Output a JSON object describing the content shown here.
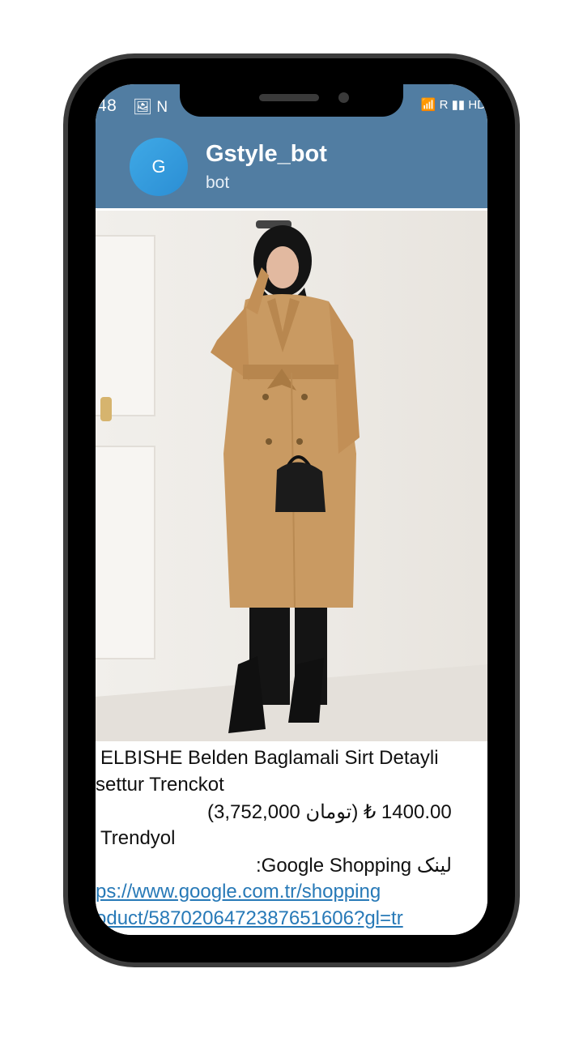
{
  "status_bar": {
    "time": "48",
    "left_icons": "🖼 N",
    "right_icons": "📶 R ▮▮ HD"
  },
  "chat": {
    "avatar_letter": "G",
    "title": "Gstyle_bot",
    "subtitle": "bot"
  },
  "message": {
    "product_line1": "ELBISHE Belden Baglamali Sirt Detayli",
    "product_line2": "settur Trenckot",
    "price": "(3,752,000 تومان) ₺ 1400.00",
    "store": "Trendyol",
    "google_label": ":Google Shopping لینک",
    "link_line1": "ps://www.google.com.tr/shopping",
    "link_line2": "oduct/5870206472387651606?gl=tr"
  },
  "colors": {
    "header": "#517da2",
    "avatar": "#2b8ed4",
    "coat": "#c99a62",
    "link": "#2779b7"
  }
}
